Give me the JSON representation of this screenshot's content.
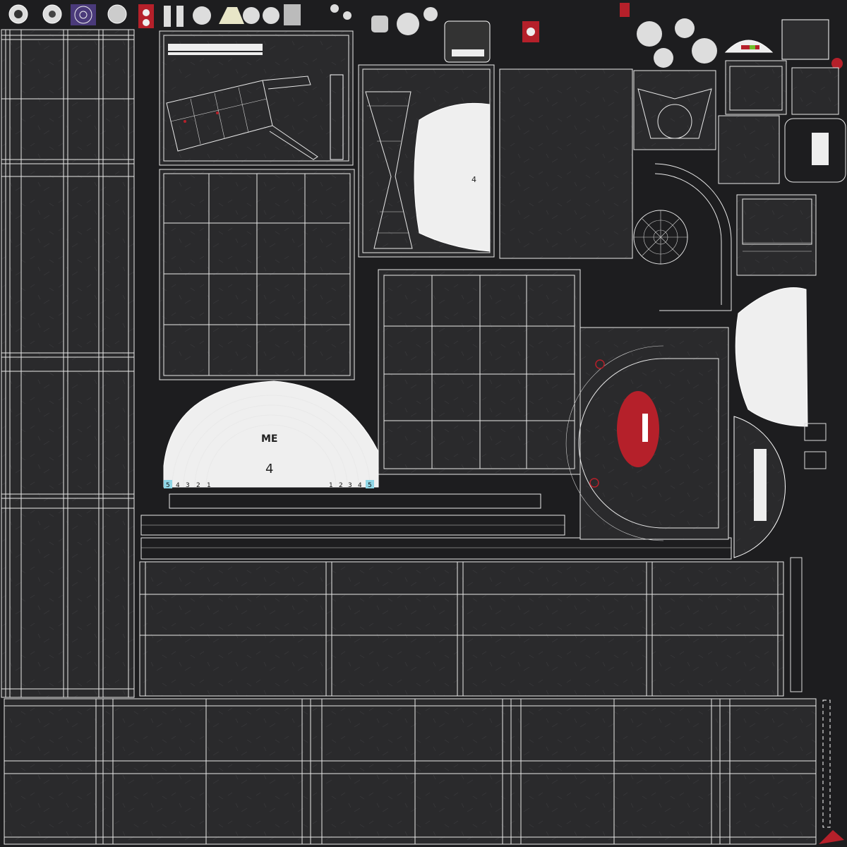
{
  "texture": {
    "background_color": "#1d1d1f",
    "panel_color": "#2a2a2c",
    "wire_color": "#e9e9e9",
    "accent_red": "#b5202a",
    "accent_cyan": "#8fd6e6",
    "accent_purple": "#4a3a7a"
  },
  "labels": {
    "me_mark": "ME",
    "letter_top": "4",
    "letter_arch": "4"
  },
  "arch_digits": {
    "left": [
      "5",
      "4",
      "3",
      "2",
      "1"
    ],
    "right": [
      "1",
      "2",
      "3",
      "4",
      "5"
    ]
  }
}
